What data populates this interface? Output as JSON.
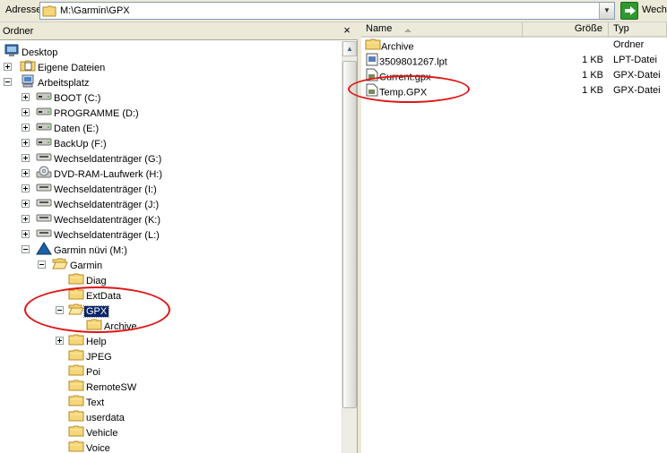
{
  "address_bar": {
    "label": "Adresse",
    "path": "M:\\Garmin\\GPX",
    "go_label": "Wech"
  },
  "folder_pane": {
    "title": "Ordner",
    "close_glyph": "×",
    "tree": [
      {
        "label": "Desktop",
        "icon": "desktop-icon"
      },
      {
        "label": "Eigene Dateien",
        "icon": "my-documents-icon"
      },
      {
        "label": "Arbeitsplatz",
        "icon": "my-computer-icon"
      },
      {
        "label": "BOOT (C:)",
        "icon": "hard-drive-icon"
      },
      {
        "label": "PROGRAMME (D:)",
        "icon": "hard-drive-icon"
      },
      {
        "label": "Daten (E:)",
        "icon": "hard-drive-icon"
      },
      {
        "label": "BackUp (F:)",
        "icon": "hard-drive-icon"
      },
      {
        "label": "Wechseldatenträger (G:)",
        "icon": "removable-drive-icon"
      },
      {
        "label": "DVD-RAM-Laufwerk (H:)",
        "icon": "dvd-drive-icon"
      },
      {
        "label": "Wechseldatenträger (I:)",
        "icon": "removable-drive-icon"
      },
      {
        "label": "Wechseldatenträger (J:)",
        "icon": "removable-drive-icon"
      },
      {
        "label": "Wechseldatenträger (K:)",
        "icon": "removable-drive-icon"
      },
      {
        "label": "Wechseldatenträger (L:)",
        "icon": "removable-drive-icon"
      },
      {
        "label": "Garmin nüvi (M:)",
        "icon": "garmin-drive-icon"
      },
      {
        "label": "Garmin",
        "icon": "folder-open-icon"
      },
      {
        "label": "Diag",
        "icon": "folder-icon"
      },
      {
        "label": "ExtData",
        "icon": "folder-icon"
      },
      {
        "label": "GPX",
        "icon": "folder-open-icon",
        "selected": true
      },
      {
        "label": "Archive",
        "icon": "folder-icon"
      },
      {
        "label": "Help",
        "icon": "folder-icon"
      },
      {
        "label": "JPEG",
        "icon": "folder-icon"
      },
      {
        "label": "Poi",
        "icon": "folder-icon"
      },
      {
        "label": "RemoteSW",
        "icon": "folder-icon"
      },
      {
        "label": "Text",
        "icon": "folder-icon"
      },
      {
        "label": "userdata",
        "icon": "folder-icon"
      },
      {
        "label": "Vehicle",
        "icon": "folder-icon"
      },
      {
        "label": "Voice",
        "icon": "folder-icon"
      }
    ]
  },
  "file_list": {
    "columns": {
      "name": "Name",
      "size": "Größe",
      "type": "Typ"
    },
    "rows": [
      {
        "name": "Archive",
        "size": "",
        "type": "Ordner",
        "icon": "folder-icon"
      },
      {
        "name": "3509801267.lpt",
        "size": "1 KB",
        "type": "LPT-Datei",
        "icon": "lpt-file-icon"
      },
      {
        "name": "Current.gpx",
        "size": "1 KB",
        "type": "GPX-Datei",
        "icon": "gpx-file-icon"
      },
      {
        "name": "Temp.GPX",
        "size": "1 KB",
        "type": "GPX-Datei",
        "icon": "gpx-file-icon"
      }
    ]
  },
  "colors": {
    "selection": "#0A246A",
    "annotation": "#E01515",
    "folder": "#F5D77A"
  }
}
